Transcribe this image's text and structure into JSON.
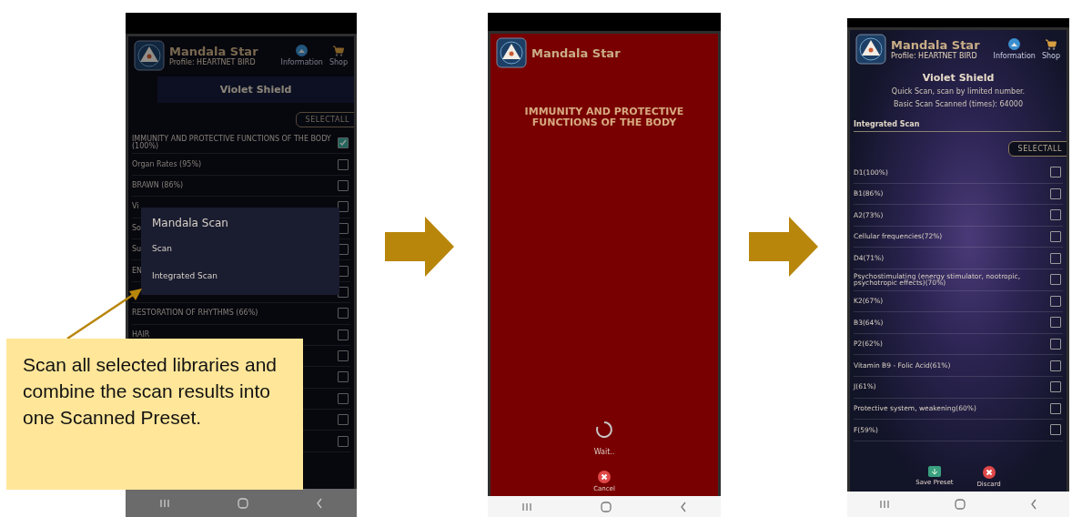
{
  "screens": [
    {
      "kind": "list",
      "app_title": "Mandala Star",
      "profile": "Profile: HEARTNET BIRD",
      "header_buttons": [
        "Information",
        "Shop"
      ],
      "preset_title": "Violet Shield",
      "select_all": "SELECTALL",
      "rows": [
        {
          "label": "IMMUNITY AND PROTECTIVE FUNCTIONS OF THE BODY (100%)",
          "checked": true
        },
        {
          "label": "Organ Rates (95%)",
          "checked": false
        },
        {
          "label": "BRAWN (86%)",
          "checked": false
        },
        {
          "label": "Vi",
          "checked": false
        },
        {
          "label": "So",
          "checked": false
        },
        {
          "label": "Su",
          "checked": false
        },
        {
          "label": "EN",
          "checked": false
        },
        {
          "checked": false
        },
        {
          "label": "RESTORATION OF RHYTHMS (66%)",
          "checked": false
        },
        {
          "label": "HAIR",
          "checked": false
        },
        {
          "checked": false
        },
        {
          "checked": false
        },
        {
          "checked": false
        },
        {
          "checked": false
        },
        {
          "checked": false
        }
      ],
      "dialog": {
        "title": "Mandala Scan",
        "options": [
          "Scan",
          "Integrated Scan"
        ]
      }
    },
    {
      "kind": "progress",
      "app_title": "Mandala Star",
      "heading": "IMMUNITY AND PROTECTIVE FUNCTIONS OF THE BODY",
      "status": "Wait..",
      "cancel": "Cancel"
    },
    {
      "kind": "list",
      "app_title": "Mandala Star",
      "profile": "Profile: HEARTNET BIRD",
      "header_buttons": [
        "Information",
        "Shop"
      ],
      "preset_title": "Violet Shield",
      "info_lines": [
        "Quick Scan, scan by limited number.",
        "Basic Scan Scanned (times): 64000"
      ],
      "section_title": "Integrated Scan",
      "select_all": "SELECTALL",
      "rows": [
        {
          "label": "D1(100%)",
          "checked": false
        },
        {
          "label": "B1(86%)",
          "checked": false
        },
        {
          "label": "A2(73%)",
          "checked": false
        },
        {
          "label": "Cellular frequencies(72%)",
          "checked": false
        },
        {
          "label": "D4(71%)",
          "checked": false
        },
        {
          "label": "Psychostimulating (energy stimulator, nootropic, psychotropic effects)(70%)",
          "checked": false
        },
        {
          "label": "K2(67%)",
          "checked": false
        },
        {
          "label": "B3(64%)",
          "checked": false
        },
        {
          "label": "P2(62%)",
          "checked": false
        },
        {
          "label": "Vitamin B9 - Folic Acid(61%)",
          "checked": false
        },
        {
          "label": "J(61%)",
          "checked": false
        },
        {
          "label": "Protective system, weakening(60%)",
          "checked": false
        },
        {
          "label": "F(59%)",
          "checked": false
        }
      ],
      "footer_buttons": [
        "Save Preset",
        "Discard"
      ]
    }
  ],
  "callout": {
    "text": "Scan all selected libraries and combine the scan results into one Scanned Preset."
  }
}
